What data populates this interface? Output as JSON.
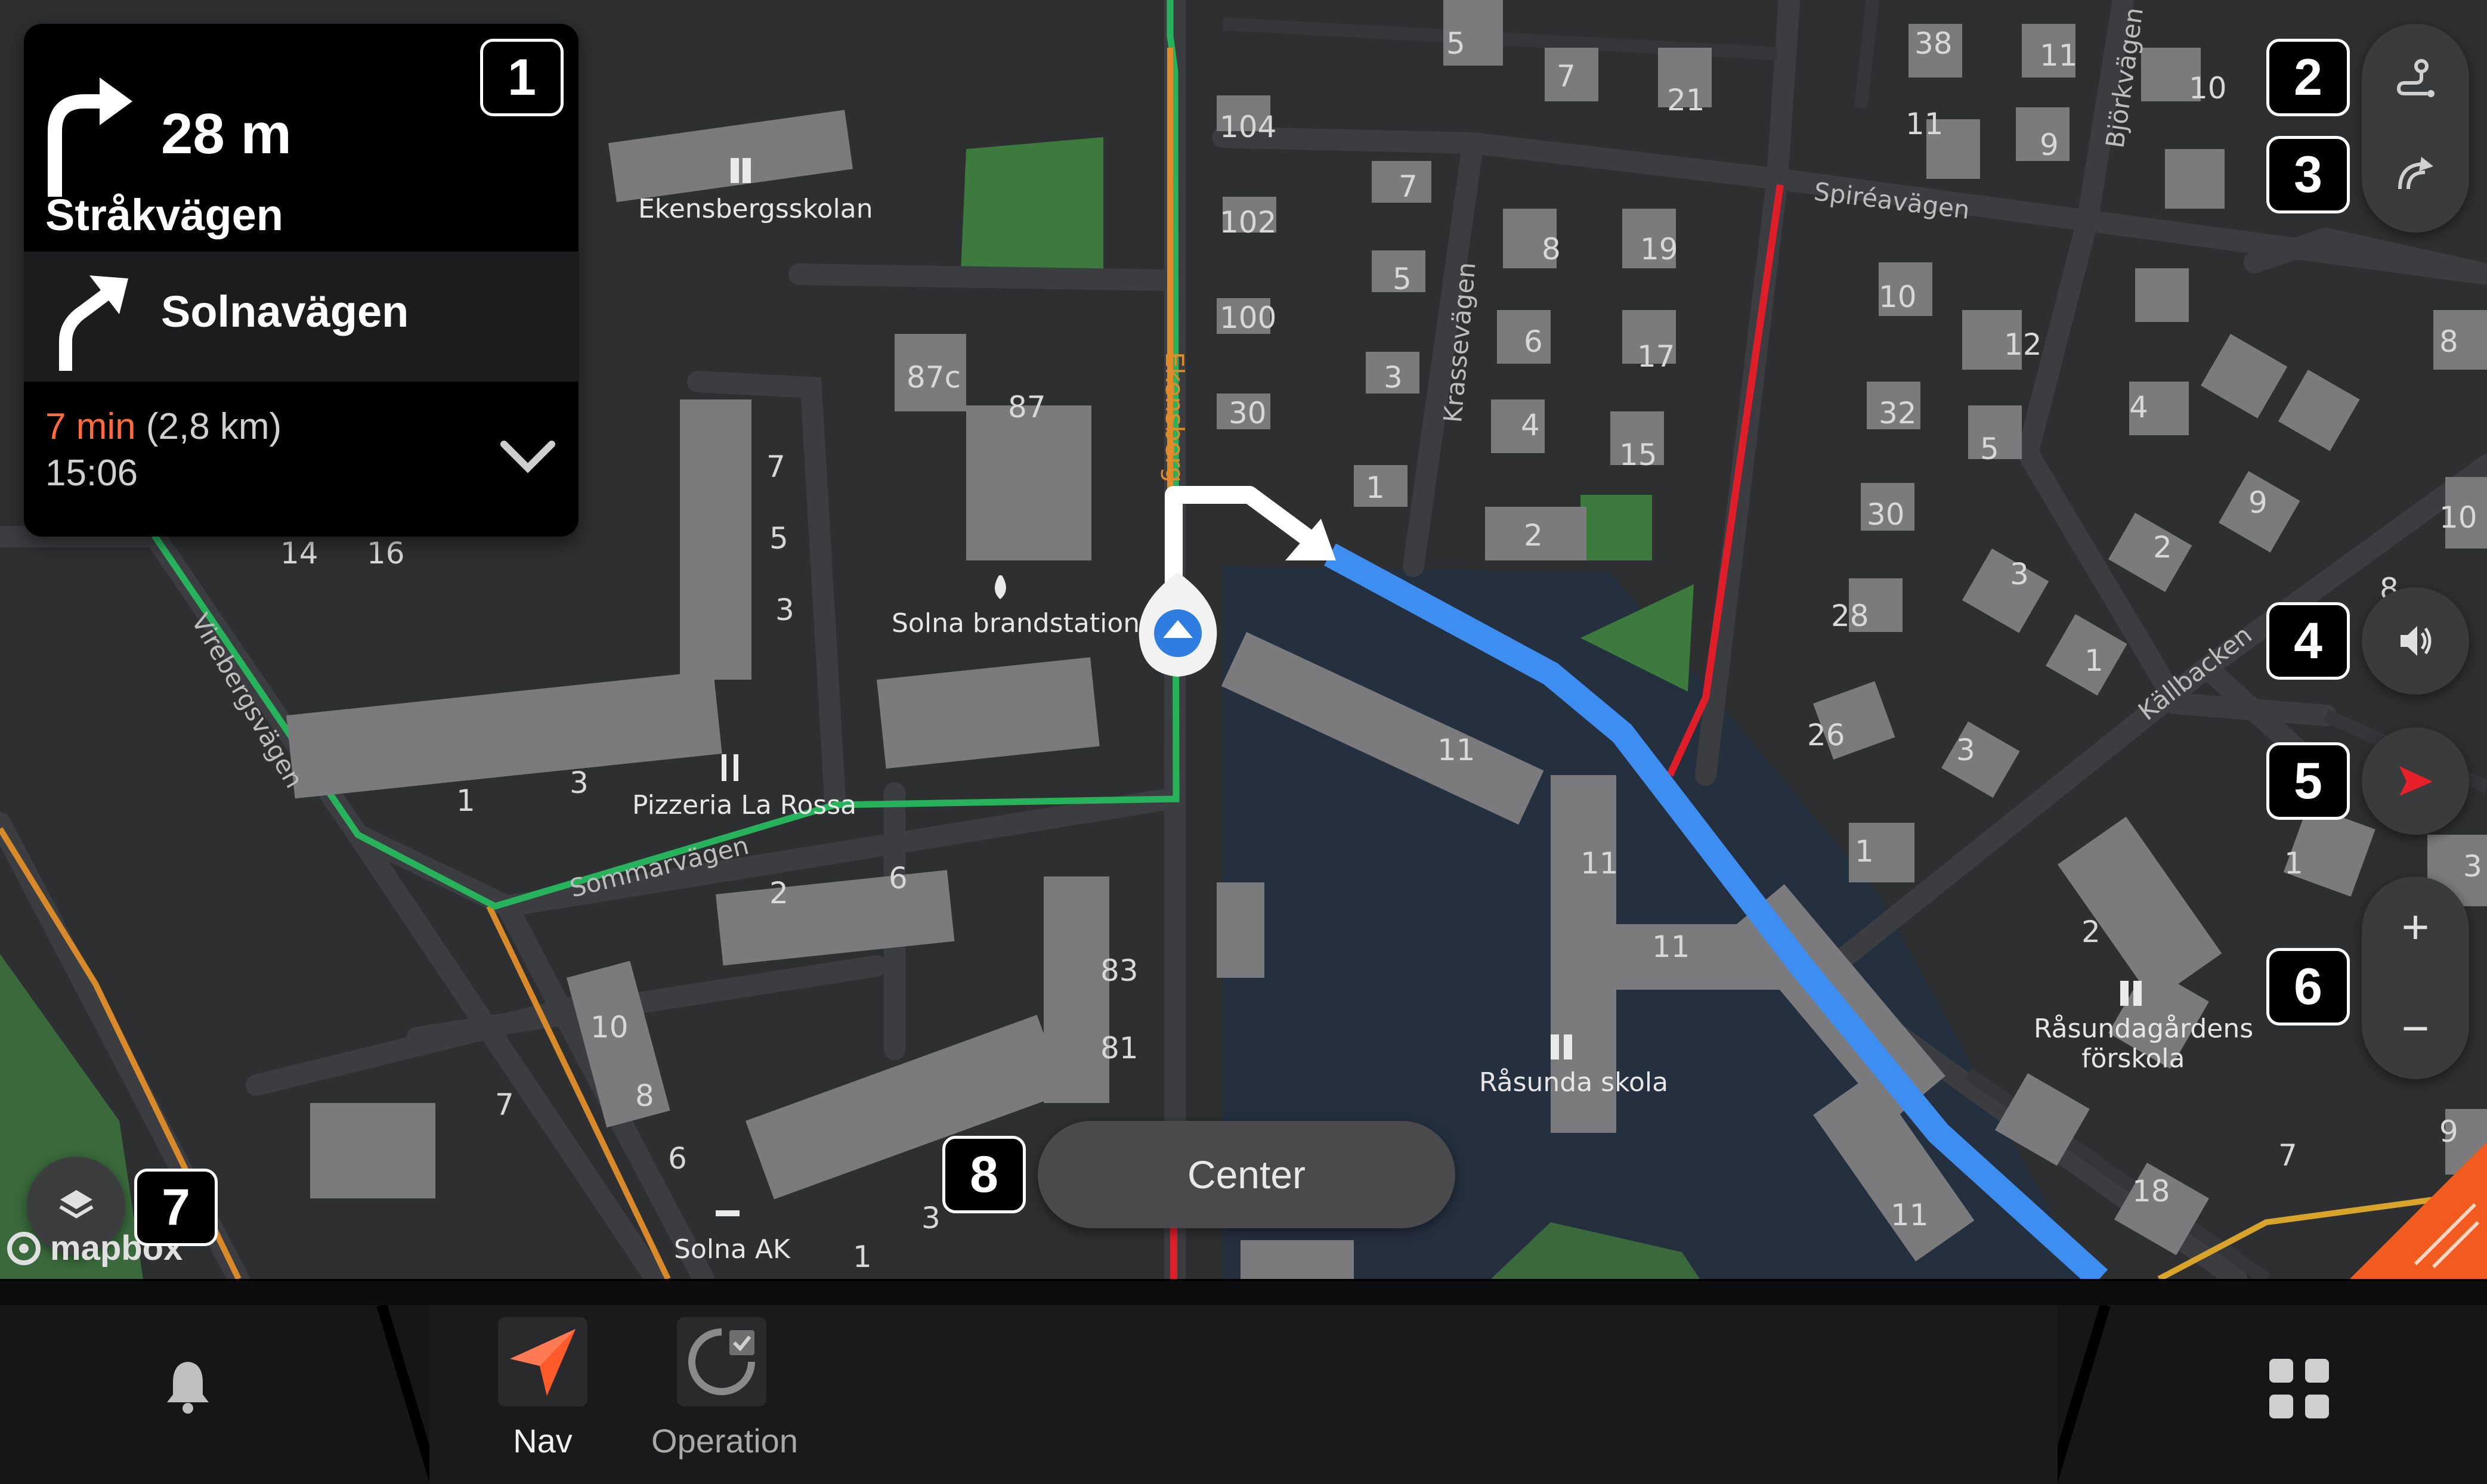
{
  "maneuver": {
    "primary_distance": "28 m",
    "primary_street": "Stråkvägen",
    "secondary_street": "Solnavägen",
    "eta_minutes": "7 min",
    "eta_distance": "(2,8 km)",
    "eta_arrival": "15:06"
  },
  "map": {
    "pois": [
      {
        "label": "Ekensbergsskolan"
      },
      {
        "label": "Solna brandstation"
      },
      {
        "label": "Pizzeria La Rossa"
      },
      {
        "label": "Råsunda skola"
      },
      {
        "label": "Råsundagårdens"
      },
      {
        "label": "förskola"
      },
      {
        "label": "Solna AK"
      }
    ],
    "streets": [
      "Spiréavägen",
      "Björkvägen",
      "Krassevägen",
      "Ekensberg",
      "Vireberg­svägen",
      "Sommarvägen",
      "Källbacken"
    ],
    "numbers": [
      "104",
      "102",
      "100",
      "30",
      "87c",
      "87",
      "7",
      "5",
      "3",
      "14",
      "16",
      "1",
      "3",
      "2",
      "6",
      "83",
      "81",
      "10",
      "8",
      "6",
      "7",
      "1",
      "3",
      "11",
      "11",
      "11",
      "11",
      "5",
      "7",
      "21",
      "38",
      "11",
      "10",
      "11",
      "9",
      "7",
      "5",
      "3",
      "1",
      "8",
      "19",
      "6",
      "17",
      "4",
      "15",
      "2",
      "10",
      "12",
      "32",
      "5",
      "4",
      "8",
      "30",
      "3",
      "2",
      "9",
      "10",
      "28",
      "1",
      "26",
      "3",
      "1",
      "1",
      "2",
      "3",
      "7",
      "18",
      "9",
      "8"
    ],
    "attribution": "mapbox"
  },
  "controls": {
    "center_label": "Center",
    "zoom_in": "+",
    "zoom_out": "−"
  },
  "badges": [
    "1",
    "2",
    "3",
    "4",
    "5",
    "6",
    "7",
    "8"
  ],
  "bottombar": {
    "nav_label": "Nav",
    "operation_label": "Operation"
  },
  "colors": {
    "route": "#3d8ef0",
    "green_route": "#27b35b",
    "red_route": "#e01e2a",
    "eta_accent": "#ff6b3d"
  }
}
